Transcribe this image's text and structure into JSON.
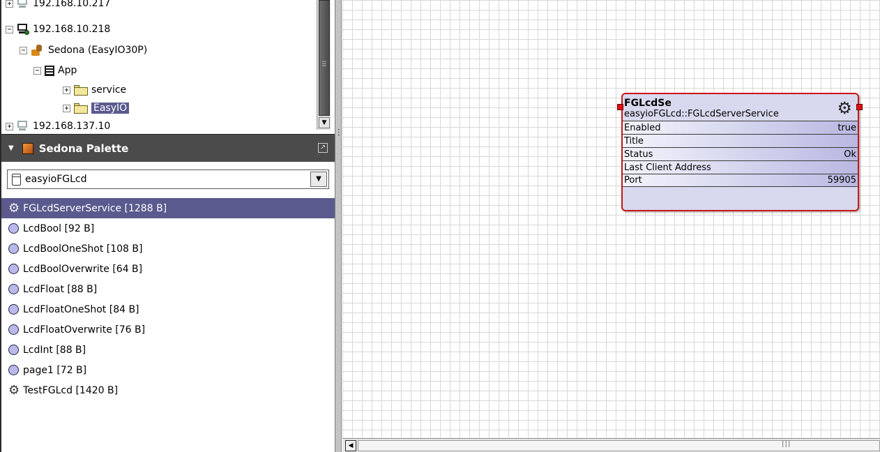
{
  "nav_tree": {
    "items": [
      {
        "expander": "+",
        "label": "192.168.10.217",
        "icon": "host-icon"
      },
      {
        "expander": "−",
        "label": "192.168.10.218",
        "icon": "host-connected-icon"
      },
      {
        "expander": "−",
        "label": "Sedona (EasyIO30P)",
        "icon": "sedona-icon"
      },
      {
        "expander": "−",
        "label": "App",
        "icon": "app-icon"
      },
      {
        "expander": "+",
        "label": "service",
        "icon": "folder-icon"
      },
      {
        "expander": "+",
        "label": "EasyIO",
        "icon": "folder-icon"
      },
      {
        "expander": "+",
        "label": "192.168.137.10",
        "icon": "host-icon"
      }
    ]
  },
  "palette": {
    "title": "Sedona Palette",
    "kit_selected": "easyioFGLcd",
    "items": [
      {
        "label": "FGLcdServerService [1288 B]",
        "icon": "gear-icon"
      },
      {
        "label": "LcdBool [92 B]",
        "icon": "circle-icon"
      },
      {
        "label": "LcdBoolOneShot [108 B]",
        "icon": "circle-icon"
      },
      {
        "label": "LcdBoolOverwrite [64 B]",
        "icon": "circle-icon"
      },
      {
        "label": "LcdFloat [88 B]",
        "icon": "circle-icon"
      },
      {
        "label": "LcdFloatOneShot [84 B]",
        "icon": "circle-icon"
      },
      {
        "label": "LcdFloatOverwrite [76 B]",
        "icon": "circle-icon"
      },
      {
        "label": "LcdInt [88 B]",
        "icon": "circle-icon"
      },
      {
        "label": "page1 [72 B]",
        "icon": "circle-icon"
      },
      {
        "label": "TestFGLcd [1420 B]",
        "icon": "gear-icon"
      }
    ]
  },
  "component": {
    "name": "FGLcdSe",
    "type": "easyioFGLcd::FGLcdServerService",
    "slots": [
      {
        "name": "Enabled",
        "value": "true"
      },
      {
        "name": "Title",
        "value": ""
      },
      {
        "name": "Status",
        "value": "Ok"
      },
      {
        "name": "Last Client Address",
        "value": ""
      },
      {
        "name": "Port",
        "value": "59905"
      }
    ]
  },
  "colors": {
    "selection": "#5a5a8e",
    "link_point": "#e01010",
    "component_border": "#c81616"
  }
}
